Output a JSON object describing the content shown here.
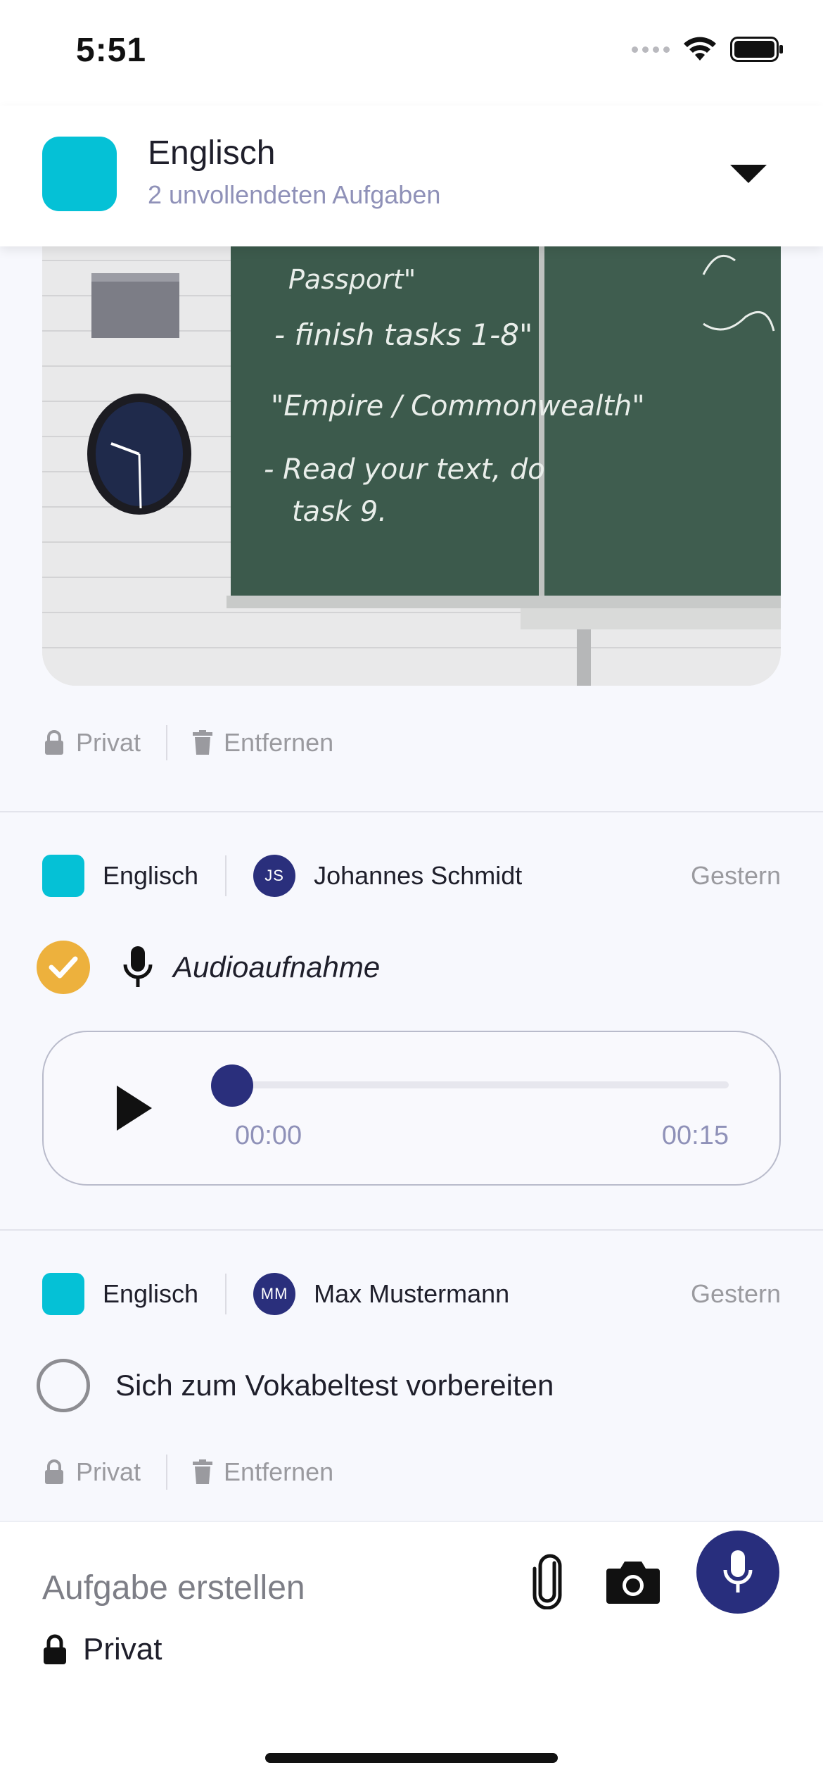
{
  "status_bar": {
    "time": "5:51"
  },
  "header": {
    "title": "Englisch",
    "subtitle": "2 unvollendeten Aufgaben",
    "accent_color": "#05c1d6"
  },
  "photo_post": {
    "chalkboard_lines": [
      "Passport\"",
      "- finish tasks 1-8\"",
      "\"Empire / Commonwealth\"",
      "- Read your text, do",
      "task 9."
    ],
    "actions": {
      "private_label": "Privat",
      "remove_label": "Entfernen"
    }
  },
  "audio_post": {
    "subject": "Englisch",
    "author_initials": "JS",
    "author_name": "Johannes Schmidt",
    "date": "Gestern",
    "task_title": "Audioaufnahme",
    "completed": true,
    "player": {
      "current_time": "00:00",
      "total_time": "00:15",
      "progress": 0
    }
  },
  "vocab_post": {
    "subject": "Englisch",
    "author_initials": "MM",
    "author_name": "Max Mustermann",
    "date": "Gestern",
    "task_title": "Sich zum Vokabeltest vorbereiten",
    "completed": false,
    "actions": {
      "private_label": "Privat",
      "remove_label": "Entfernen"
    }
  },
  "composer": {
    "placeholder": "Aufgabe erstellen",
    "privacy_label": "Privat",
    "mic_color": "#282e7d"
  },
  "icons": [
    "signal-icon",
    "wifi-icon",
    "battery-icon",
    "chevron-down-icon",
    "lock-icon",
    "trash-icon",
    "checkmark-icon",
    "microphone-icon",
    "play-icon",
    "paperclip-icon",
    "camera-icon"
  ]
}
